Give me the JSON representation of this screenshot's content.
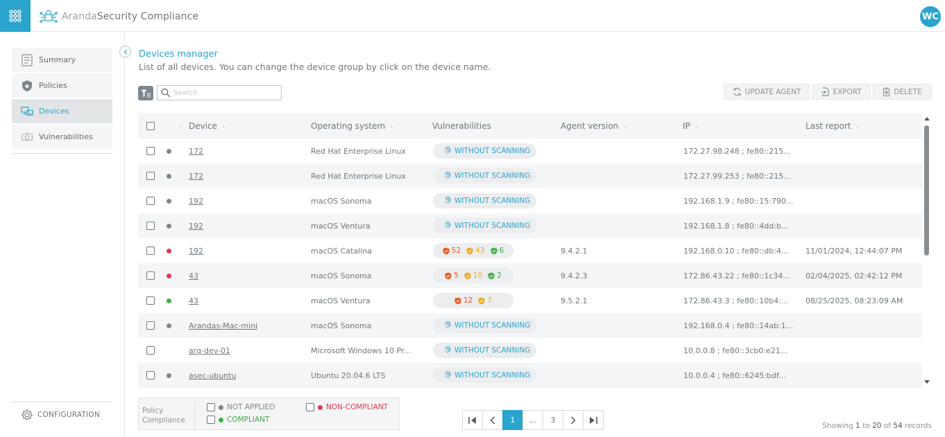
{
  "app": {
    "brand_light": "Aranda",
    "brand_bold": "Security Compliance",
    "user_initials": "WC"
  },
  "sidebar": {
    "items": [
      {
        "label": "Summary",
        "icon": "summary-icon"
      },
      {
        "label": "Policies",
        "icon": "shield-star-icon"
      },
      {
        "label": "Devices",
        "icon": "devices-icon",
        "active": true
      },
      {
        "label": "Vulnerabilities",
        "icon": "vulnerabilities-icon"
      }
    ],
    "config_label": "CONFIGURATION"
  },
  "page": {
    "title": "Devices manager",
    "subtitle": "List of all devices. You can change the device group by click on the device name."
  },
  "toolbar": {
    "search_placeholder": "Search",
    "update_agent": "UPDATE AGENT",
    "export": "EXPORT",
    "delete": "DELETE"
  },
  "table": {
    "columns": [
      "Device",
      "Operating system",
      "Vulnerabilities",
      "Agent version",
      "IP",
      "Last report"
    ],
    "rows": [
      {
        "status": "gray",
        "device": "172",
        "os": "Red Hat Enterprise Linux",
        "vuln": "WITHOUT SCANNING",
        "agent": "",
        "ip": "172.27.98.248 ; fe80::215...",
        "last": ""
      },
      {
        "status": "gray",
        "device": "172",
        "os": "Red Hat Enterprise Linux",
        "vuln": "WITHOUT SCANNING",
        "agent": "",
        "ip": "172.27.99.253 ; fe80::215...",
        "last": ""
      },
      {
        "status": "gray",
        "device": "192",
        "os": "macOS Sonoma",
        "vuln": "WITHOUT SCANNING",
        "agent": "",
        "ip": "192.168.1.9 ; fe80::15:790...",
        "last": ""
      },
      {
        "status": "gray",
        "device": "192",
        "os": "macOS Ventura",
        "vuln": "WITHOUT SCANNING",
        "agent": "",
        "ip": "192.168.1.8 ; fe80::4dd:b...",
        "last": ""
      },
      {
        "status": "red",
        "device": "192",
        "os": "macOS Catalina",
        "vuln_counts": {
          "high": "52",
          "medium": "43",
          "low": "6"
        },
        "agent": "9.4.2.1",
        "ip": "192.168.0.10 ; fe80::db:4...",
        "last": "11/01/2024, 12:44:07 PM"
      },
      {
        "status": "red",
        "device": "43",
        "os": "macOS Sonoma",
        "vuln_counts": {
          "high": "5",
          "medium": "10",
          "low": "2"
        },
        "agent": "9.4.2.3",
        "ip": "172.86.43.22 ; fe80::1c34...",
        "last": "02/04/2025, 02:42:12 PM"
      },
      {
        "status": "green",
        "device": "43",
        "os": "macOS Ventura",
        "vuln_counts": {
          "high": "12",
          "medium": "7"
        },
        "agent": "9.5.2.1",
        "ip": "172.86.43.3 ; fe80::10b4:...",
        "last": "08/25/2025, 08:23:09 AM"
      },
      {
        "status": "gray",
        "device": "Arandas-Mac-mini",
        "os": "macOS Sonoma",
        "vuln": "WITHOUT SCANNING",
        "agent": "",
        "ip": "192.168.0.4 ; fe80::14ab:1...",
        "last": ""
      },
      {
        "status": "none",
        "device": "arq-dev-01",
        "os": "Microsoft Windows 10 Pr...",
        "vuln": "WITHOUT SCANNING",
        "agent": "",
        "ip": "10.0.0.8 ; fe80::3cb0:e21...",
        "last": ""
      },
      {
        "status": "gray",
        "device": "asec-ubuntu",
        "os": "Ubuntu 20.04.6 LTS",
        "vuln": "WITHOUT SCANNING",
        "agent": "",
        "ip": "10.0.0.4 ; fe80::6245:bdf...",
        "last": ""
      }
    ]
  },
  "legend": {
    "title_line1": "Policy",
    "title_line2": "Compliance",
    "not_applied": "NOT APPLIED",
    "compliant": "COMPLIANT",
    "non_compliant": "NON-COMPLIANT"
  },
  "pagination": {
    "pages": [
      "1",
      "...",
      "3"
    ],
    "current": "1",
    "records_prefix": "Showing",
    "from": "1",
    "to_word": "to",
    "to": "20",
    "of_word": "of",
    "total": "54",
    "suffix": "records"
  },
  "colors": {
    "accent": "#2aa4cc",
    "status_gray": "#7d878d",
    "status_red": "#e5384f",
    "status_green": "#3cb043",
    "vuln_high": "#e85b1c",
    "vuln_medium": "#f0a81e",
    "vuln_low": "#3cb043"
  }
}
